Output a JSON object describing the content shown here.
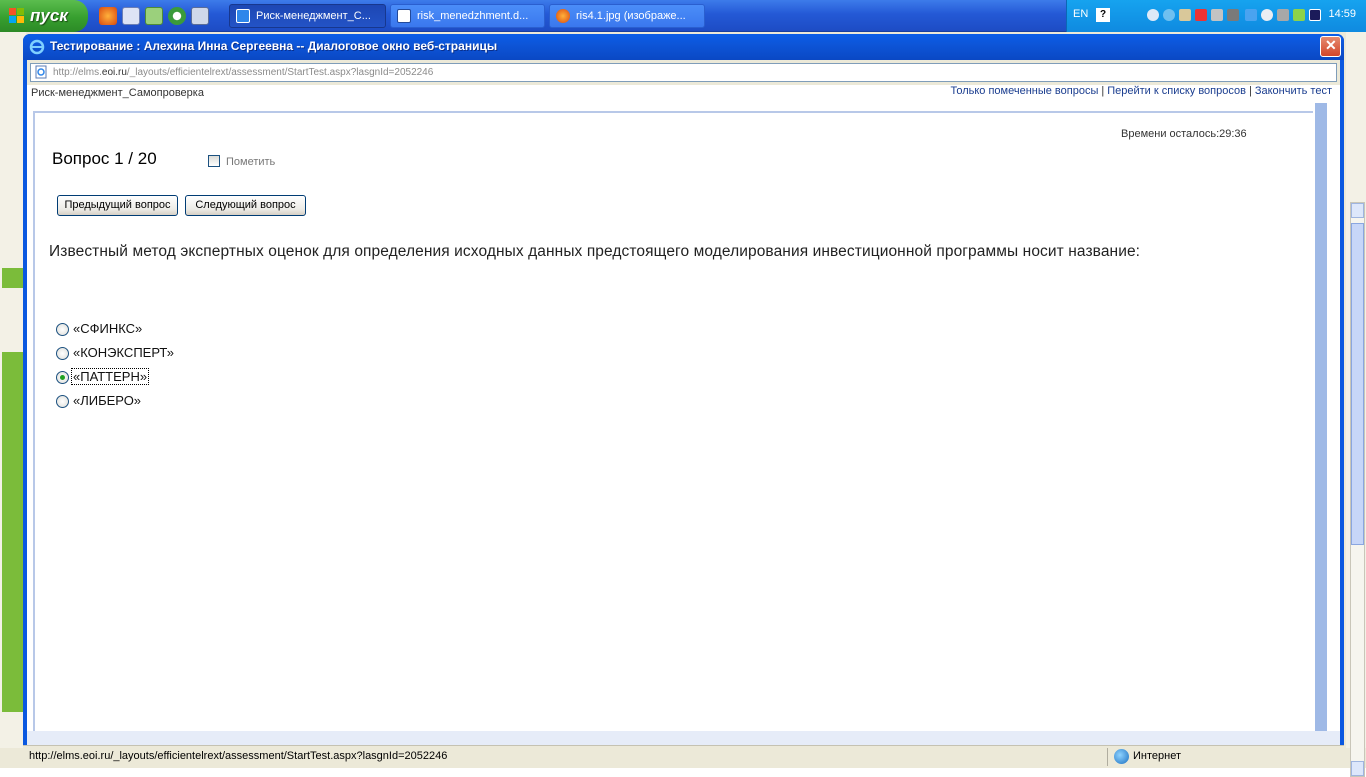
{
  "taskbar": {
    "start_label": "пуск",
    "tasks": [
      {
        "label": "Риск-менеджмент_С...",
        "active": true
      },
      {
        "label": "risk_menedzhment.d...",
        "active": false
      },
      {
        "label": "ris4.1.jpg (изображе...",
        "active": false
      }
    ],
    "language": "EN",
    "help_symbol": "?",
    "clock": "14:59"
  },
  "dialog": {
    "title": "Тестирование : Алехина Инна Сергеевна -- Диалоговое окно веб-страницы",
    "close_symbol": "✕",
    "address_prefix": "http://elms.",
    "address_domain": "eoi.ru",
    "address_rest": "/_layouts/efficientelrext/assessment/StartTest.aspx?lasgnId=2052246"
  },
  "topbar": {
    "course": "Риск-менеджмент_Самопроверка",
    "links": [
      "Только помеченные вопросы",
      "Перейти к списку вопросов",
      "Закончить тест"
    ],
    "separator": "|"
  },
  "test": {
    "timer": "Времени осталось:29:36",
    "question_number": "Вопрос 1 / 20",
    "mark_label": "Пометить",
    "prev_button": "Предыдущий вопрос",
    "next_button": "Следующий вопрос",
    "question_text": "Известный метод экспертных оценок для определения исходных данных предстоящего моделирования инвестиционной программы носит название:",
    "options": [
      {
        "label": "«СФИНКС»",
        "selected": false
      },
      {
        "label": "«КОНЭКСПЕРТ»",
        "selected": false
      },
      {
        "label": "«ПАТТЕРН»",
        "selected": true
      },
      {
        "label": "«ЛИБЕРО»",
        "selected": false
      }
    ]
  },
  "statusbar": {
    "url": "http://elms.eoi.ru/_layouts/efficientelrext/assessment/StartTest.aspx?lasgnId=2052246",
    "zone": "Интернет"
  },
  "colors": {
    "title_bar": "#0a58e0",
    "start_button": "#379f2f",
    "link": "#1a3d8f",
    "selected_radio": "#21a121"
  }
}
